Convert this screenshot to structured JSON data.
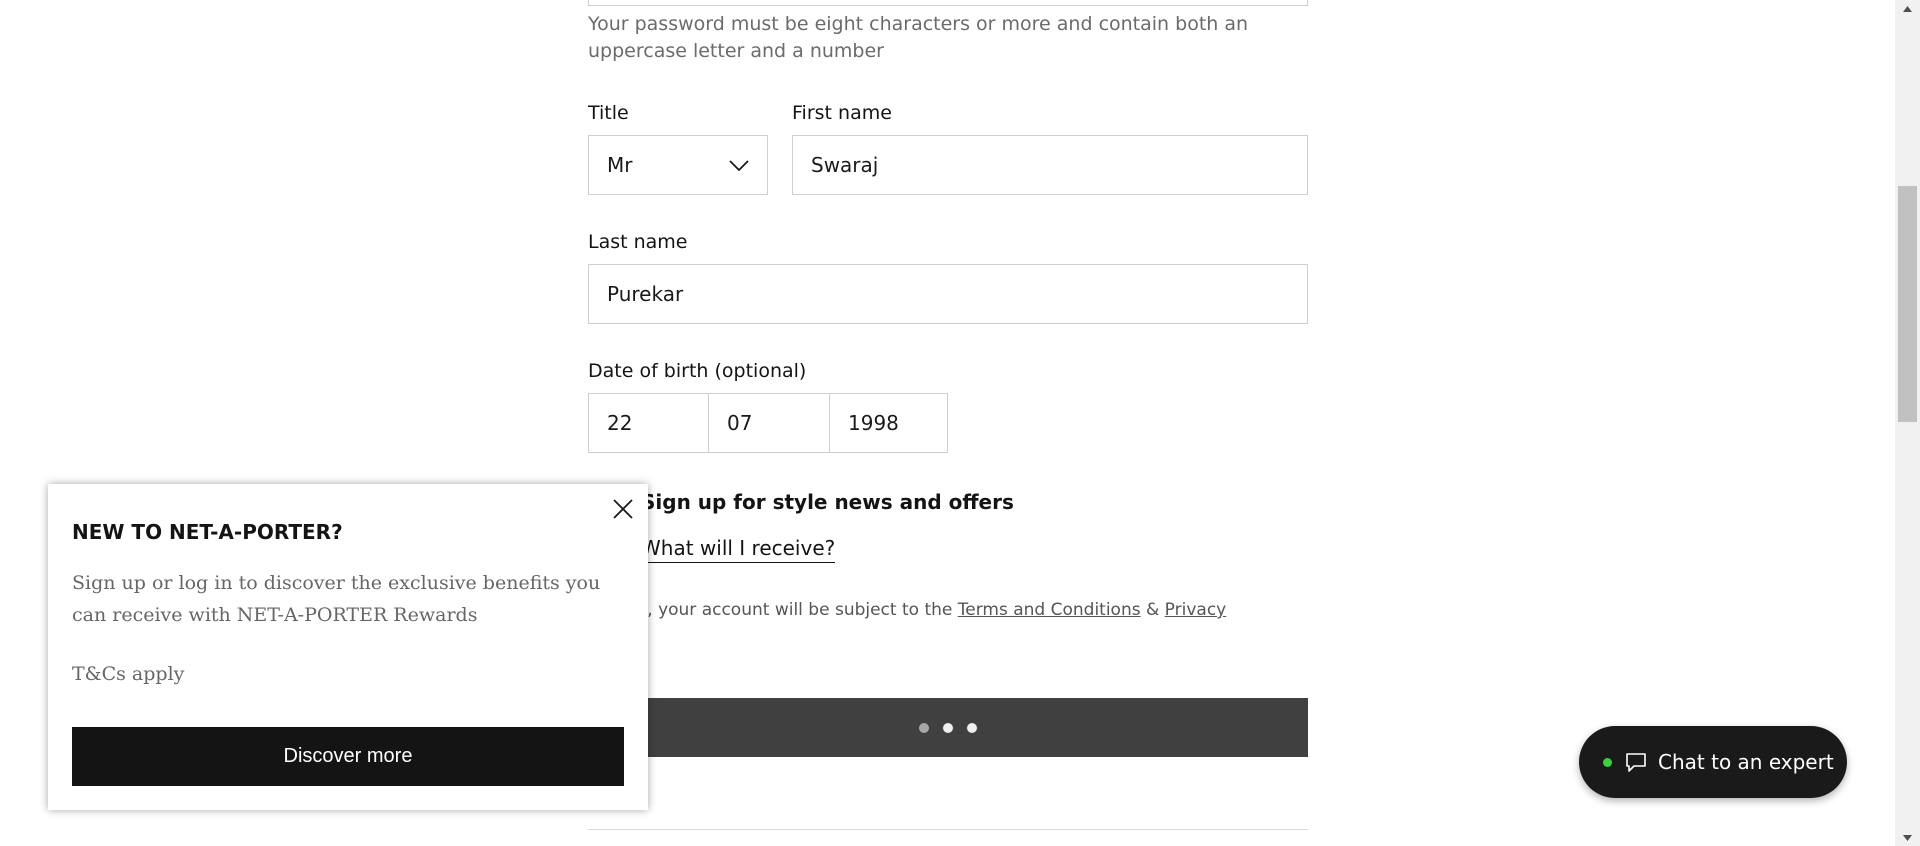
{
  "form": {
    "password_helper": "Your password must be eight characters or more and contain both an uppercase letter and a number",
    "title": {
      "label": "Title",
      "value": "Mr"
    },
    "first_name": {
      "label": "First name",
      "value": "Swaraj"
    },
    "last_name": {
      "label": "Last name",
      "value": "Purekar"
    },
    "dob": {
      "label": "Date of birth (optional)",
      "day": "22",
      "month": "07",
      "year": "1998"
    },
    "newsletter_label": "Sign up for style news and offers",
    "receive_link": "What will I receive?",
    "terms": {
      "prefix": "stering, your account will be subject to the ",
      "terms_link": "Terms and Conditions",
      "amp": " & ",
      "privacy_link": "Privacy"
    }
  },
  "popup": {
    "title": "NEW TO NET-A-PORTER?",
    "description": "Sign up or log in to discover the exclusive benefits you can receive with NET-A-PORTER Rewards",
    "tcs": "T&Cs apply",
    "button": "Discover more"
  },
  "chat": {
    "label": "Chat to an expert",
    "status_color": "#35d63a"
  },
  "icons": {
    "dropdown": "chevron-down-icon",
    "close": "close-icon",
    "chat": "chat-bubble-icon",
    "loading": "loading-dots"
  }
}
